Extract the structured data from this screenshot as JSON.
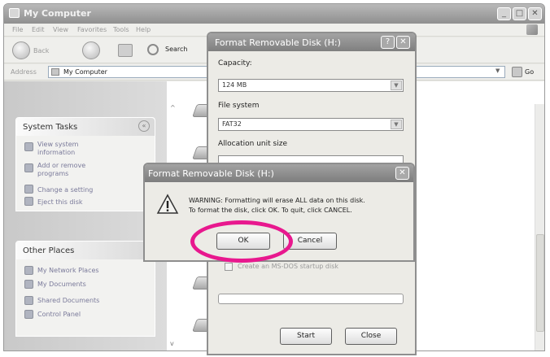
{
  "explorer": {
    "title": "My Computer",
    "menu": [
      "File",
      "Edit",
      "View",
      "Favorites",
      "Tools",
      "Help"
    ],
    "toolbar": {
      "back_label": "Back",
      "search_label": "Search"
    },
    "address": {
      "label": "Address",
      "value": "My Computer",
      "go_label": "Go"
    },
    "system_tasks": {
      "title": "System Tasks",
      "items": [
        "View system information",
        "Add or remove programs",
        "Change a setting",
        "Eject this disk"
      ]
    },
    "other_places": {
      "title": "Other Places",
      "items": [
        "My Network Places",
        "My Documents",
        "Shared Documents",
        "Control Panel"
      ]
    }
  },
  "format_dialog": {
    "title": "Format Removable Disk (H:)",
    "help_label": "?",
    "capacity": {
      "label": "Capacity:",
      "value": "124 MB"
    },
    "file_system": {
      "label": "File system",
      "value": "FAT32"
    },
    "allocation": {
      "label": "Allocation unit size"
    },
    "msdos_label": "Create an MS-DOS startup disk",
    "start_label": "Start",
    "close_label": "Close"
  },
  "warning_dialog": {
    "title": "Format Removable Disk (H:)",
    "message_line1": "WARNING: Formatting will erase ALL data on this disk.",
    "message_line2": "To format the disk, click OK. To quit, click CANCEL.",
    "ok_label": "OK",
    "cancel_label": "Cancel"
  },
  "colors": {
    "highlight_ring": "#e8188e"
  }
}
